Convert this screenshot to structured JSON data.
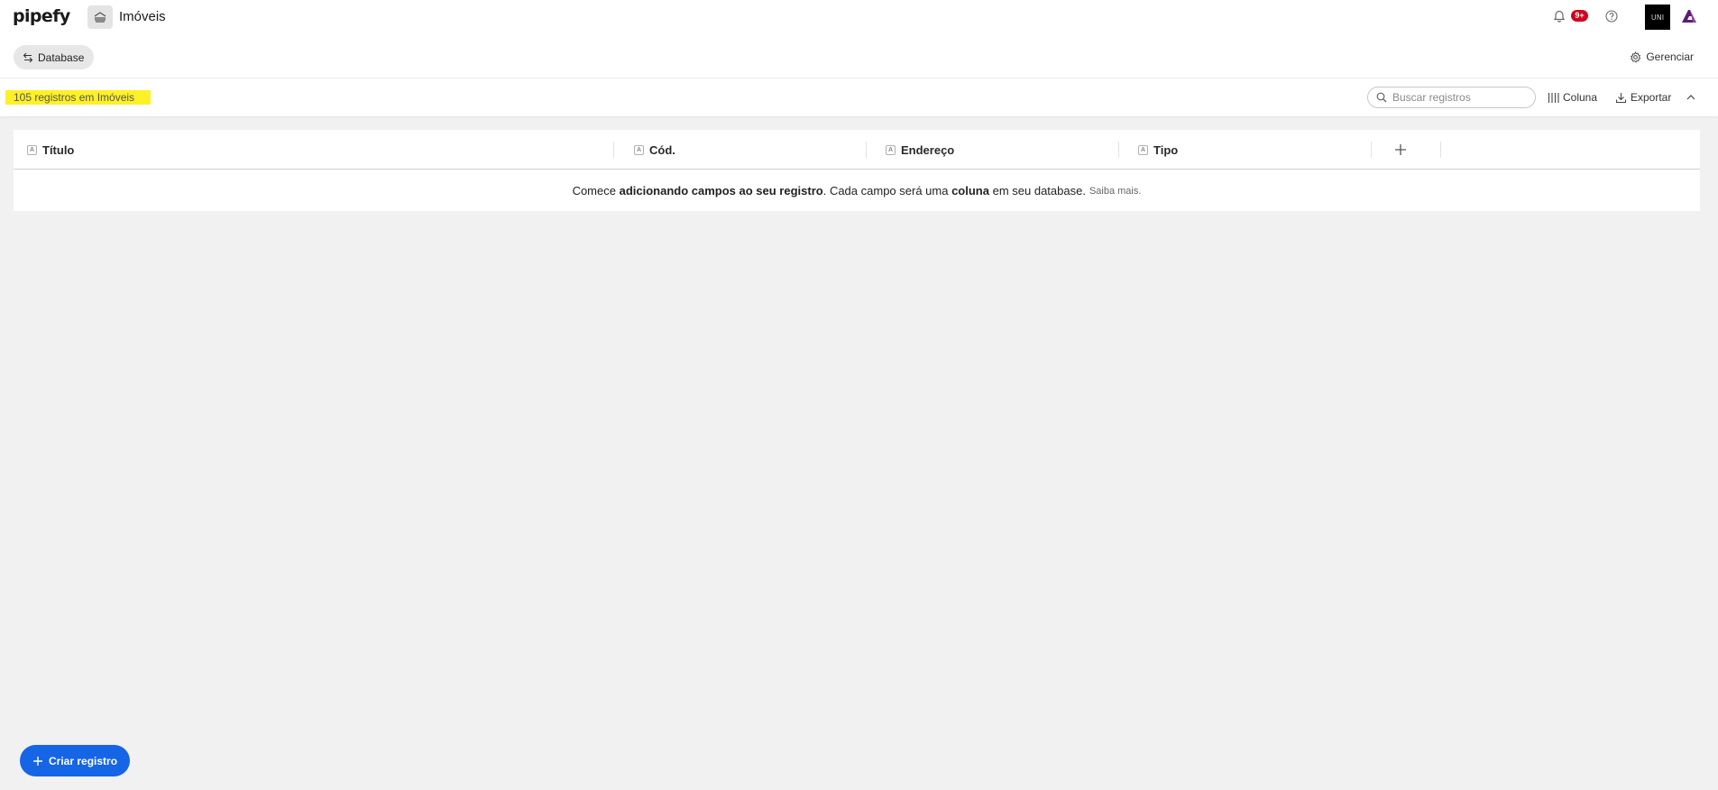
{
  "header": {
    "logo": "pipefy",
    "title": "Imóveis",
    "notification_badge": "9+",
    "avatar_text": "UNI"
  },
  "subheader": {
    "database_label": "Database",
    "manage_label": "Gerenciar"
  },
  "toolbar": {
    "record_count": "105 registros em Imóveis",
    "search_placeholder": "Buscar registros",
    "column_label": "Coluna",
    "export_label": "Exportar"
  },
  "table": {
    "columns": [
      {
        "label": "Título",
        "type_icon": "A"
      },
      {
        "label": "Cód.",
        "type_icon": "A"
      },
      {
        "label": "Endereço",
        "type_icon": "A"
      },
      {
        "label": "Tipo",
        "type_icon": "A"
      }
    ],
    "empty": {
      "t1": "Comece ",
      "b1": "adicionando campos ao seu registro",
      "t2": ". Cada campo será uma ",
      "b2": "coluna",
      "t3": " em seu database.",
      "link": "Saiba mais."
    }
  },
  "fab": {
    "label": "Criar registro"
  },
  "colors": {
    "primary": "#1565e6",
    "badge": "#d1001f",
    "highlight": "#fff027",
    "brand_purple": "#5b1e6e"
  }
}
